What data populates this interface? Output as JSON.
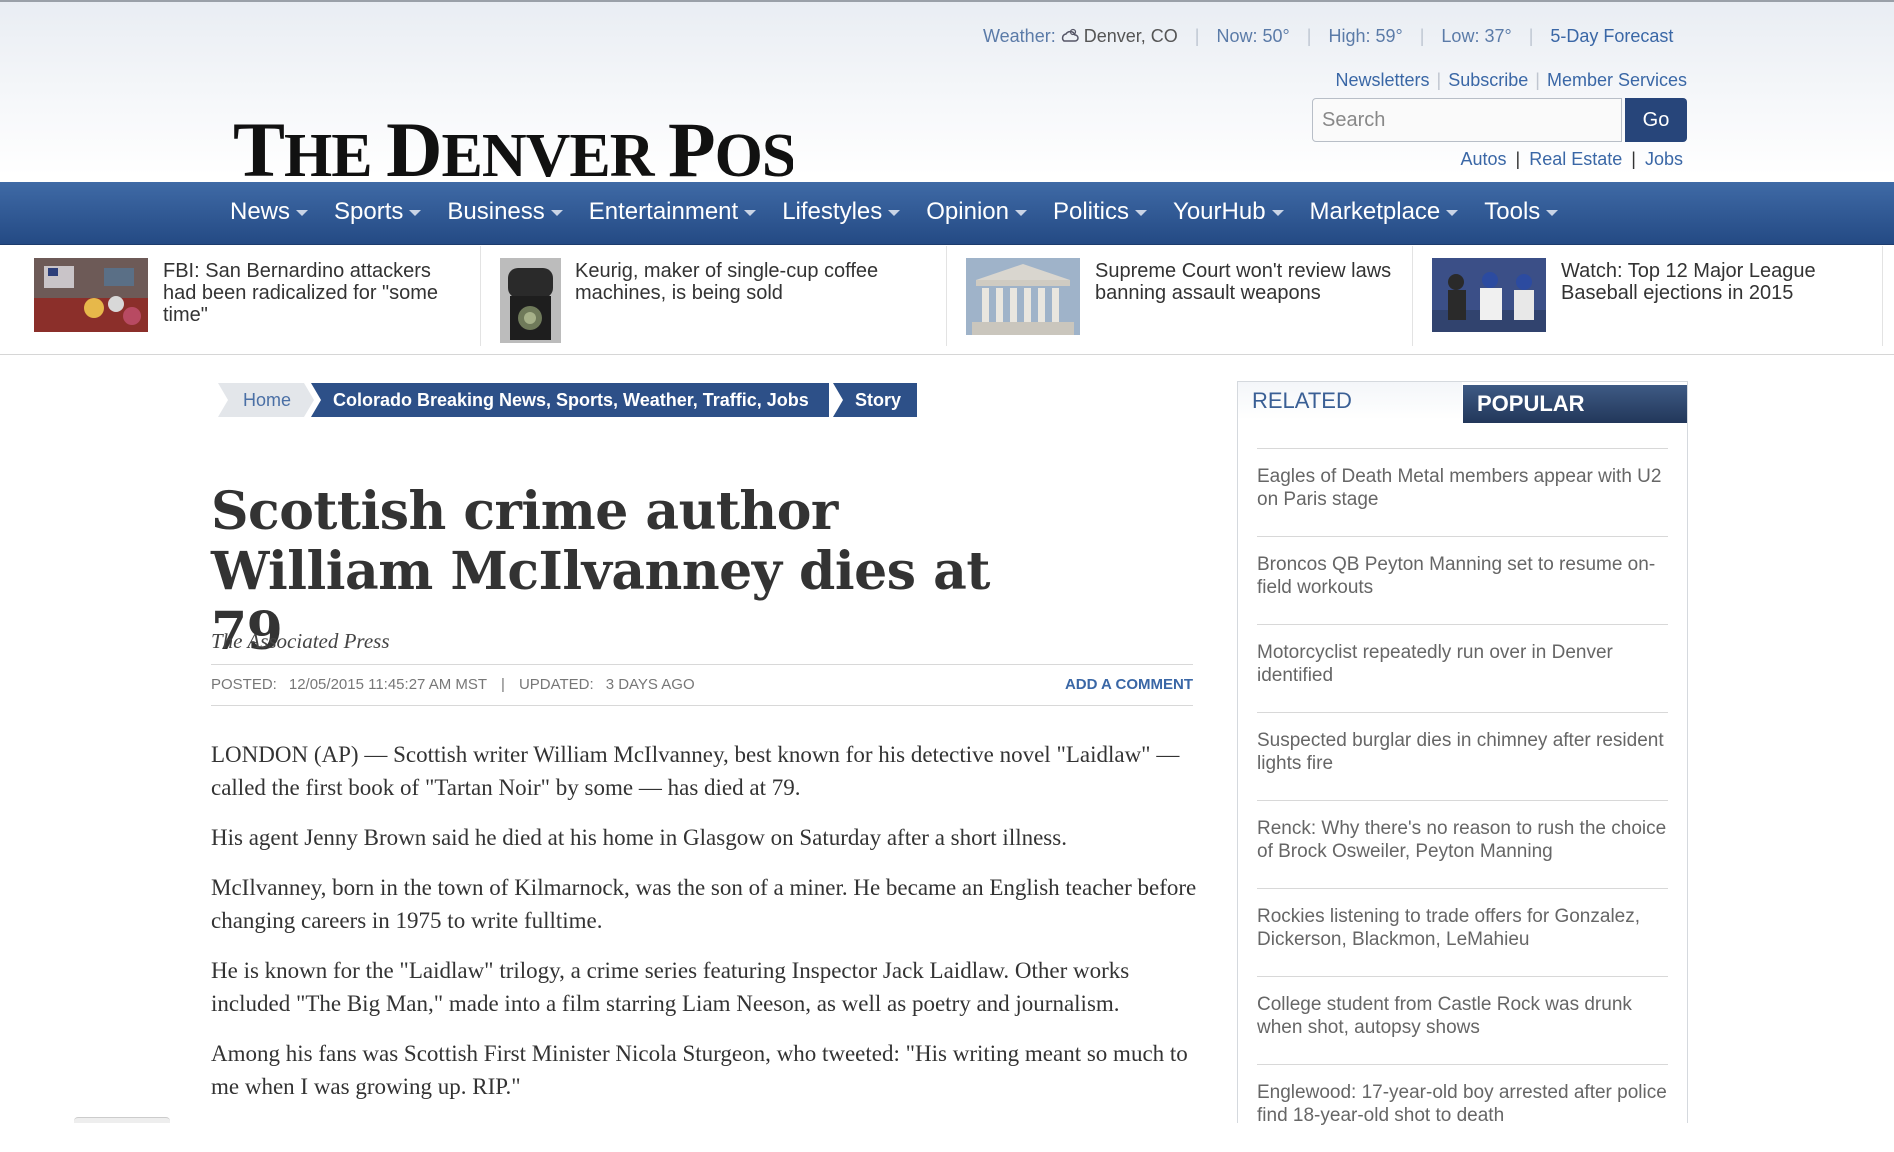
{
  "weather": {
    "label": "Weather:",
    "location": "Denver, CO",
    "now": "Now: 50°",
    "high": "High: 59°",
    "low": "Low: 37°",
    "forecast": "5-Day Forecast"
  },
  "top_links": [
    "Newsletters",
    "Subscribe",
    "Member Services"
  ],
  "search": {
    "placeholder": "Search",
    "button": "Go"
  },
  "classifieds": [
    "Autos",
    "Real Estate",
    "Jobs"
  ],
  "logo": "The Denver Post",
  "nav": [
    "News",
    "Sports",
    "Business",
    "Entertainment",
    "Lifestyles",
    "Opinion",
    "Politics",
    "YourHub",
    "Marketplace",
    "Tools"
  ],
  "strip": [
    {
      "title": "FBI: San Bernardino attackers had been radicalized for \"some time\""
    },
    {
      "title": "Keurig, maker of single-cup coffee machines, is being sold"
    },
    {
      "title": "Supreme Court won't review laws banning assault weapons"
    },
    {
      "title": "Watch: Top 12 Major League Baseball ejections in 2015"
    }
  ],
  "breadcrumb": [
    "Home",
    "Colorado Breaking News, Sports, Weather, Traffic, Jobs",
    "Story"
  ],
  "article": {
    "headline": "Scottish crime author William McIlvanney dies at 79",
    "byline": "The Associated Press",
    "posted_label": "POSTED:",
    "posted_value": "12/05/2015 11:45:27 AM MST",
    "updated_label": "UPDATED:",
    "updated_value": "3 DAYS AGO",
    "add_comment": "ADD A COMMENT",
    "paragraphs": [
      "LONDON (AP) — Scottish writer William McIlvanney, best known for his detective novel \"Laidlaw\" — called the first book of \"Tartan Noir\" by some — has died at 79.",
      "His agent Jenny Brown said he died at his home in Glasgow on Saturday after a short illness.",
      "McIlvanney, born in the town of Kilmarnock, was the son of a miner. He became an English teacher before changing careers in 1975 to write fulltime.",
      "He is known for the \"Laidlaw\" trilogy, a crime series featuring Inspector Jack Laidlaw. Other works included \"The Big Man,\" made into a film starring Liam Neeson, as well as poetry and journalism.",
      "Among his fans was Scottish First Minister Nicola Sturgeon, who tweeted: \"His writing meant so much to me when I was growing up. RIP.\""
    ]
  },
  "sidebar": {
    "tab_related": "RELATED",
    "tab_popular": "POPULAR",
    "items": [
      "Eagles of Death Metal members appear with U2 on Paris stage",
      "Broncos QB Peyton Manning set to resume on-field workouts",
      "Motorcyclist repeatedly run over in Denver identified",
      "Suspected burglar dies in chimney after resident lights fire",
      "Renck: Why there's no reason to rush the choice of Brock Osweiler, Peyton Manning",
      "Rockies listening to trade offers for Gonzalez, Dickerson, Blackmon, LeMahieu",
      "College student from Castle Rock was drunk when shot, autopsy shows",
      "Englewood: 17-year-old boy arrested after police find 18-year-old shot to death"
    ]
  }
}
